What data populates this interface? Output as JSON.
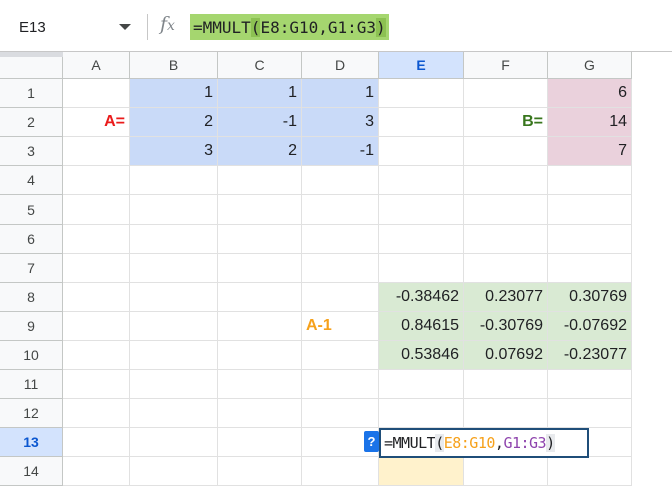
{
  "formula_bar": {
    "name_box": "E13",
    "fx_main": "f",
    "fx_sub": "x",
    "formula": {
      "prefix": "=MMULT",
      "open_paren": "(",
      "args": "E8:G10,G1:G3",
      "close_paren": ")"
    },
    "formula_highlight_color": "#a5d66f"
  },
  "grid": {
    "columns": [
      {
        "label": "A",
        "w": 0
      },
      {
        "label": "B"
      },
      {
        "label": "C"
      },
      {
        "label": "D"
      },
      {
        "label": "E"
      },
      {
        "label": "F"
      },
      {
        "label": "G"
      }
    ],
    "active_column": "E",
    "active_row": "13",
    "rows": [
      "1",
      "2",
      "3",
      "4",
      "5",
      "6",
      "7",
      "8",
      "9",
      "10",
      "11",
      "12",
      "13",
      "14"
    ],
    "cells": {
      "A2": "A=",
      "B1": "1",
      "C1": "1",
      "D1": "1",
      "B2": "2",
      "C2": "-1",
      "D2": "3",
      "B3": "3",
      "C3": "2",
      "D3": "-1",
      "F2": "B=",
      "G1": "6",
      "G2": "14",
      "G3": "7",
      "D9": "A-1",
      "E8": "-0.38462",
      "F8": "0.23077",
      "G8": "0.30769",
      "E9": "0.84615",
      "F9": "-0.30769",
      "G9": "-0.07692",
      "E10": "0.53846",
      "F10": "0.07692",
      "G10": "-0.23077"
    },
    "colors": {
      "matrix_a": "#c9daf8",
      "matrix_b": "#ead1dc",
      "inverse": "#d9ead3",
      "active_cell": "#fff2cc",
      "label_a": "#ea1b1b",
      "label_b": "#38761d",
      "label_inverse": "#f6a11b"
    }
  },
  "editor": {
    "help_label": "?",
    "prefix": "=MMULT",
    "open_paren": "(",
    "ref1": "E8:G10",
    "comma": ",",
    "ref2": "G1:G3",
    "close_paren": ")"
  }
}
